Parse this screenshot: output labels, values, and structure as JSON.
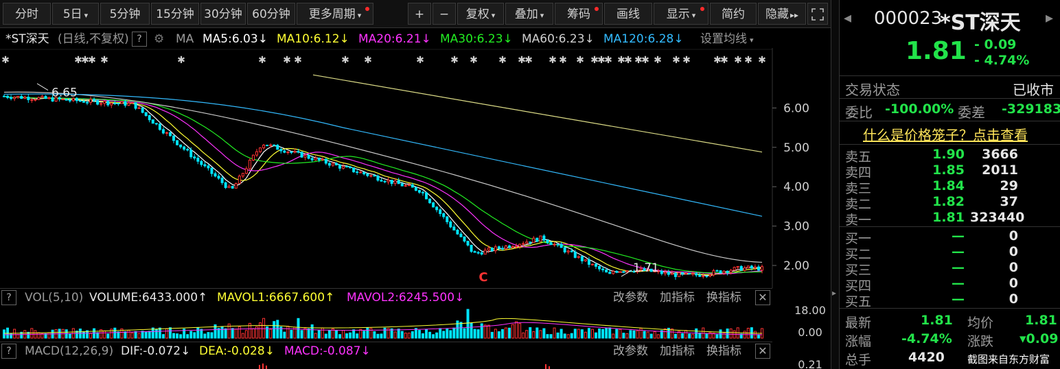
{
  "toolbar": {
    "period_tabs": [
      "分时",
      "5日",
      "5分钟",
      "15分钟",
      "30分钟",
      "60分钟",
      "更多周期"
    ],
    "zoom_in": "+",
    "zoom_out": "−",
    "adjust": "复权",
    "overlay": "叠加",
    "chips": "筹码",
    "draw": "画线",
    "display": "显示",
    "simple": "简约",
    "hide": "隐藏",
    "hide_arrows": "▸▸",
    "expand_icon": "expand-icon"
  },
  "ma_row": {
    "name": "*ST深天",
    "mode": "(日线,不复权)",
    "help": "?",
    "ma": "MA",
    "ma5": "MA5:6.03",
    "ma10": "MA10:6.12",
    "ma20": "MA20:6.21",
    "ma30": "MA30:6.23",
    "ma60": "MA60:6.23",
    "ma120": "MA120:6.28",
    "settings": "设置均线",
    "down_arrow": "↓"
  },
  "colors": {
    "up": "#ff3333",
    "down": "#00e5ff",
    "ma5": "#ffffff",
    "ma10": "#ffff33",
    "ma20": "#ff33ff",
    "ma30": "#22ee22",
    "ma60": "#cfcfcf",
    "ma120": "#33bbff",
    "green": "#22e34a"
  },
  "chart": {
    "price_labels": [
      "6.00",
      "5.00",
      "4.00",
      "3.00",
      "2.00"
    ],
    "high_label": "6.65",
    "low_label": "1.71",
    "marker": "C"
  },
  "chart_data": {
    "type": "candlestick",
    "y_range": [
      1.6,
      7.0
    ],
    "ticks": [
      6.0,
      5.0,
      4.0,
      3.0,
      2.0
    ],
    "annotations": [
      "6.65",
      "1.71"
    ],
    "moving_averages": [
      "MA5",
      "MA10",
      "MA20",
      "MA30",
      "MA60",
      "MA120"
    ]
  },
  "vol_row": {
    "help": "?",
    "name": "VOL(5,10)",
    "volume": "VOLUME:6433.000",
    "mavol1": "MAVOL1:6667.600",
    "mavol2": "MAVOL2:6245.500",
    "up_arrow": "↑",
    "down_arrow": "↓",
    "params": "改参数",
    "add": "加指标",
    "switch": "换指标",
    "close": "✕",
    "axis_top": "18.00",
    "axis_bottom": "0.00"
  },
  "macd_row": {
    "help": "?",
    "name": "MACD(12,26,9)",
    "dif": "DIF:-0.072",
    "dea": "DEA:-0.028",
    "macd": "MACD:-0.087",
    "down_arrow": "↓",
    "params": "改参数",
    "add": "加指标",
    "switch": "换指标",
    "close": "✕",
    "axis_top": "0.21"
  },
  "quote": {
    "code": "000023",
    "name": "*ST深天",
    "price": "1.81",
    "change": "- 0.09",
    "change_pct": "- 4.74%",
    "trade_status_label": "交易状态",
    "trade_status": "已收市",
    "ratio_label": "委比",
    "ratio": "-100.00%",
    "diff_label": "委差",
    "diff": "-329183",
    "cage_link": "什么是价格笼子？点击查看",
    "sell": [
      {
        "label": "卖五",
        "price": "1.90",
        "vol": "3666"
      },
      {
        "label": "卖四",
        "price": "1.85",
        "vol": "2011"
      },
      {
        "label": "卖三",
        "price": "1.84",
        "vol": "29"
      },
      {
        "label": "卖二",
        "price": "1.82",
        "vol": "37"
      },
      {
        "label": "卖一",
        "price": "1.81",
        "vol": "323440"
      }
    ],
    "buy": [
      {
        "label": "买一",
        "price": "—",
        "vol": "0"
      },
      {
        "label": "买二",
        "price": "—",
        "vol": "0"
      },
      {
        "label": "买三",
        "price": "—",
        "vol": "0"
      },
      {
        "label": "买四",
        "price": "—",
        "vol": "0"
      },
      {
        "label": "买五",
        "price": "—",
        "vol": "0"
      }
    ],
    "latest_label": "最新",
    "latest": "1.81",
    "avg_label": "均价",
    "avg": "1.81",
    "amp_label": "涨幅",
    "amp": "-4.74%",
    "chg_label": "涨跌",
    "chg": "▾0.09",
    "hands_label": "总手",
    "hands": "4420",
    "watermark": "截图来自东方财富"
  }
}
